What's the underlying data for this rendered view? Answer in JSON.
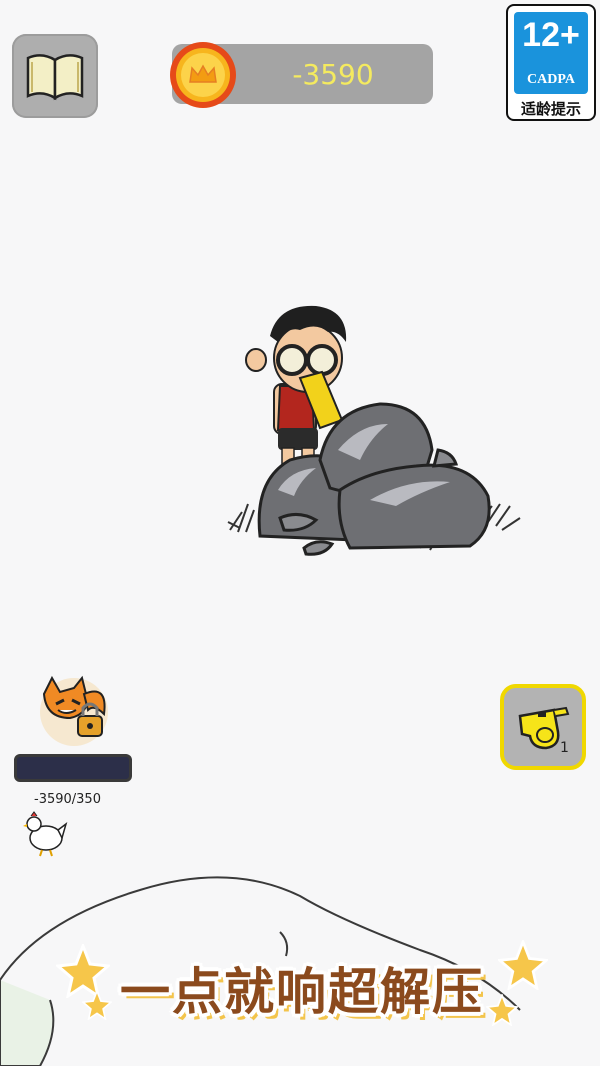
{
  "header": {
    "coin_value": "-3590",
    "age_rating": {
      "number": "12+",
      "org": "CADPA",
      "tip": "适龄提示"
    }
  },
  "unlock": {
    "progress_text": "-3590/350",
    "progress_fraction": 0
  },
  "item": {
    "count": "1"
  },
  "banner": {
    "text": "一点就响超解压"
  },
  "colors": {
    "background": "#f7f7f8",
    "coin_text": "#f4ea5f",
    "age_badge": "#1a93dc",
    "whistle_border": "#f0d800",
    "banner_text": "#8b4a1d",
    "star": "#f6c64a"
  },
  "icons": [
    "book-icon",
    "coin-icon",
    "fox-lock-icon",
    "chicken-icon",
    "whistle-icon",
    "star-icon"
  ]
}
